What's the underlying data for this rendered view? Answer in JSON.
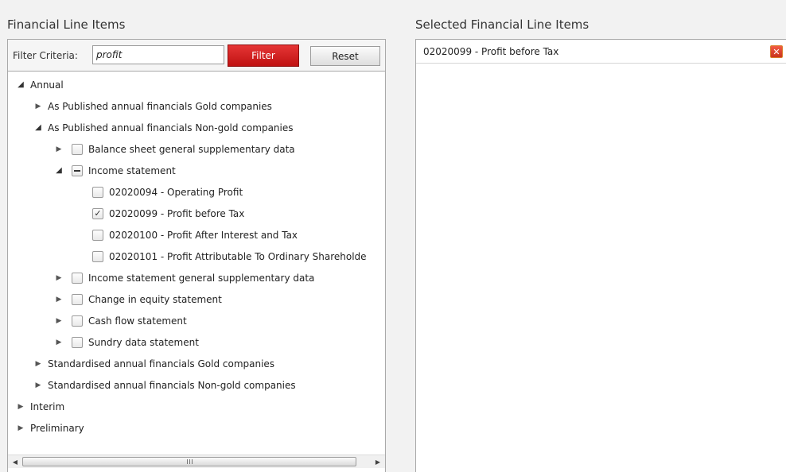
{
  "left_panel": {
    "title": "Financial Line Items",
    "filter_label": "Filter Criteria:",
    "filter_value": "profit",
    "filter_button": "Filter",
    "reset_button": "Reset"
  },
  "tree": [
    {
      "label": "Annual",
      "expanded": true
    },
    {
      "label": "As Published annual financials Gold companies",
      "expanded": false
    },
    {
      "label": "As Published annual financials Non-gold companies",
      "expanded": true
    },
    {
      "label": "Balance sheet general supplementary data",
      "expanded": false,
      "checked": false
    },
    {
      "label": "Income statement",
      "expanded": true,
      "checked": "partial"
    },
    {
      "label": "02020094 - Operating Profit",
      "checked": false
    },
    {
      "label": "02020099 - Profit before Tax",
      "checked": true
    },
    {
      "label": "02020100 - Profit After Interest and Tax",
      "checked": false
    },
    {
      "label": "02020101 - Profit Attributable To Ordinary Shareholde",
      "checked": false
    },
    {
      "label": "Income statement general supplementary data",
      "expanded": false,
      "checked": false
    },
    {
      "label": "Change in equity statement",
      "expanded": false,
      "checked": false
    },
    {
      "label": "Cash flow statement",
      "expanded": false,
      "checked": false
    },
    {
      "label": "Sundry data statement",
      "expanded": false,
      "checked": false
    },
    {
      "label": "Standardised annual financials Gold companies",
      "expanded": false
    },
    {
      "label": "Standardised annual financials Non-gold companies",
      "expanded": false
    },
    {
      "label": "Interim",
      "expanded": false
    },
    {
      "label": "Preliminary",
      "expanded": false
    }
  ],
  "right_panel": {
    "title": "Selected Financial Line Items",
    "items": [
      {
        "label": "02020099 - Profit before Tax"
      }
    ]
  },
  "icons": {
    "collapsed": "triangle-right-icon",
    "expanded": "triangle-down-icon",
    "remove": "close-icon"
  },
  "colors": {
    "accent": "#cc1a1a",
    "remove_button": "#e04a31"
  }
}
